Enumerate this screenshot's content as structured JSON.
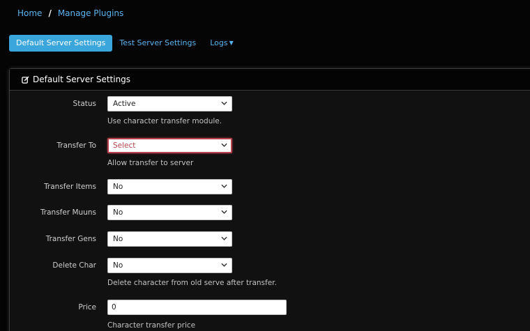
{
  "breadcrumb": {
    "home": "Home",
    "separator": "/",
    "current": "Manage Plugins"
  },
  "tabs": [
    {
      "label": "Default Server Settings",
      "active": true
    },
    {
      "label": "Test Server Settings",
      "active": false
    },
    {
      "label": "Logs",
      "active": false,
      "dropdown": true
    }
  ],
  "panel": {
    "title": "Default Server Settings",
    "icon": "edit-icon",
    "fields": {
      "status": {
        "label": "Status",
        "value": "Active",
        "help": "Use character transfer module."
      },
      "transfer_to": {
        "label": "Transfer To",
        "value": "Select",
        "help": "Allow transfer to server",
        "invalid": true
      },
      "transfer_items": {
        "label": "Transfer Items",
        "value": "No"
      },
      "transfer_muuns": {
        "label": "Transfer Muuns",
        "value": "No"
      },
      "transfer_gens": {
        "label": "Transfer Gens",
        "value": "No"
      },
      "delete_char": {
        "label": "Delete Char",
        "value": "No",
        "help": "Delete character from old serve after transfer."
      },
      "price": {
        "label": "Price",
        "value": "0",
        "help": "Character transfer price"
      }
    }
  },
  "colors": {
    "accent": "#3aa6dc",
    "link": "#5ab4f0",
    "invalid": "#b8434e",
    "background": "#050505"
  }
}
